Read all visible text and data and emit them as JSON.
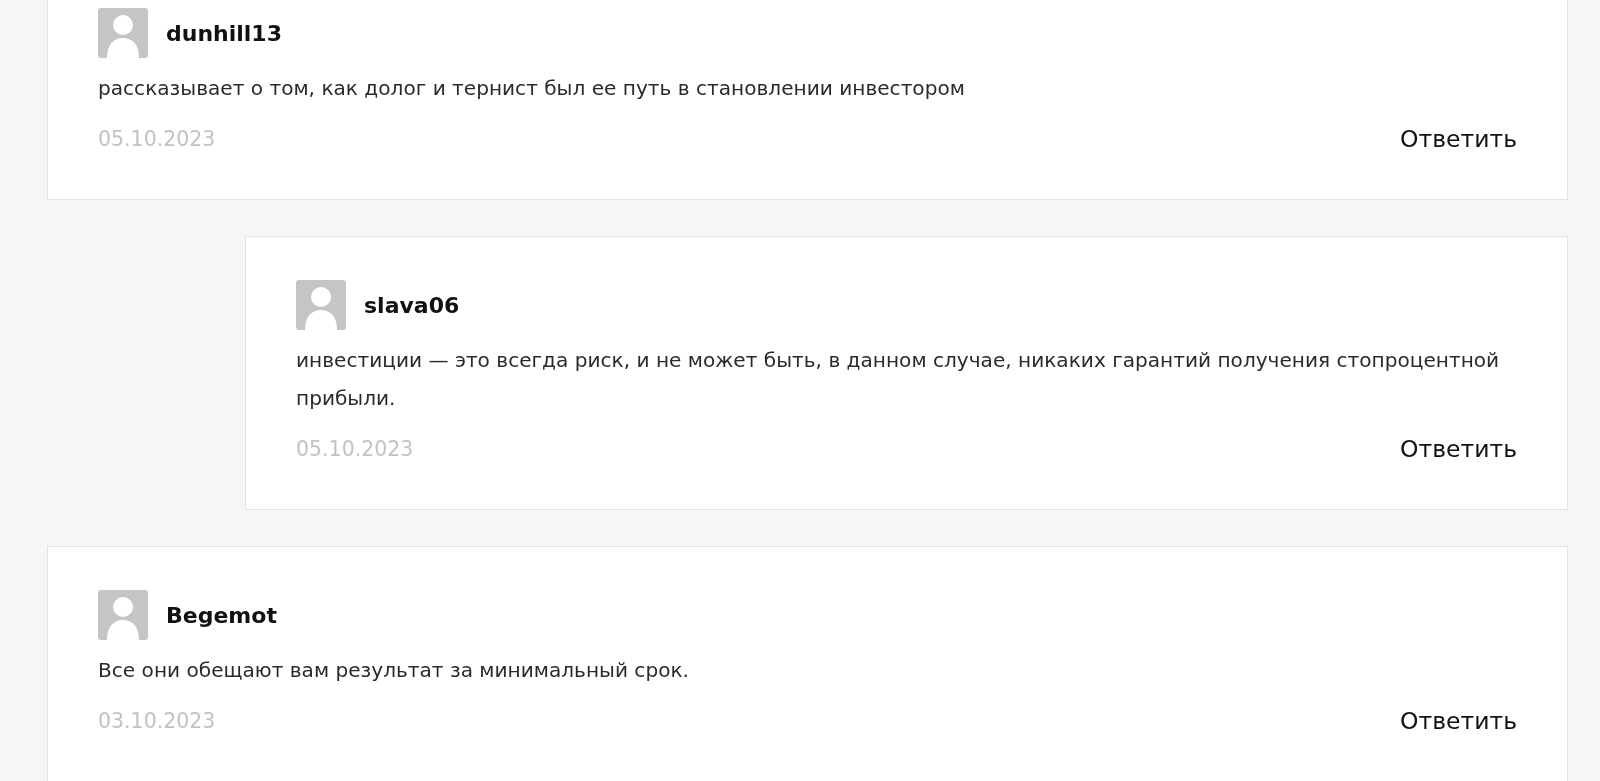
{
  "comments": [
    {
      "author": "dunhill13",
      "text": "рассказывает о том, как долог и тернист был ее путь в становлении инвестором",
      "date": "05.10.2023",
      "reply_label": "Ответить",
      "children": [
        {
          "author": "slava06",
          "text": "инвестиции — это всегда риск, и не может быть, в данном случае, никаких гарантий получения стопроцентной прибыли.",
          "date": "05.10.2023",
          "reply_label": "Ответить"
        }
      ]
    },
    {
      "author": "Begemot",
      "text": "Все они обещают вам результат за минимальный срок.",
      "date": "03.10.2023",
      "reply_label": "Ответить"
    }
  ]
}
